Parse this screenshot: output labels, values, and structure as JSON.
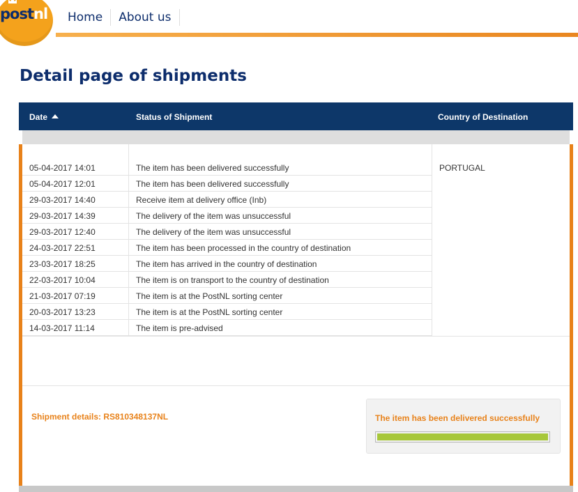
{
  "header": {
    "logo": {
      "part1": "post",
      "part2": "nl",
      "brand_orange": "#f4a21c",
      "brand_navy": "#0d2d6c"
    },
    "nav": [
      "Home",
      "About us"
    ]
  },
  "page_title": "Detail page of shipments",
  "table": {
    "columns": {
      "date": "Date",
      "status": "Status of Shipment",
      "country": "Country of Destination"
    },
    "sort_icon": "sort-ascending-icon",
    "country_value": "PORTUGAL",
    "rows": [
      {
        "date": "05-04-2017 14:01",
        "status": "The item has been delivered successfully"
      },
      {
        "date": "05-04-2017 12:01",
        "status": "The item has been delivered successfully"
      },
      {
        "date": "29-03-2017 14:40",
        "status": "Receive item at delivery office (Inb)"
      },
      {
        "date": "29-03-2017 14:39",
        "status": "The delivery of the item was unsuccessful"
      },
      {
        "date": "29-03-2017 12:40",
        "status": "The delivery of the item was unsuccessful"
      },
      {
        "date": "24-03-2017 22:51",
        "status": "The item has been processed in the country of destination"
      },
      {
        "date": "23-03-2017 18:25",
        "status": "The item has arrived in the country of destination"
      },
      {
        "date": "22-03-2017 10:04",
        "status": "The item is on transport to the country of destination"
      },
      {
        "date": "21-03-2017 07:19",
        "status": "The item is at the PostNL sorting center"
      },
      {
        "date": "20-03-2017 13:23",
        "status": "The item is at the PostNL sorting center"
      },
      {
        "date": "14-03-2017 11:14",
        "status": "The item is pre-advised"
      }
    ]
  },
  "footer": {
    "shipment_details": "Shipment details: RS810348137NL",
    "status_text": "The item has been delivered successfully",
    "progress": 1.0,
    "colors": {
      "accent": "#e8821a",
      "progress": "#a7c73a",
      "header_bg": "#0d3769"
    }
  }
}
